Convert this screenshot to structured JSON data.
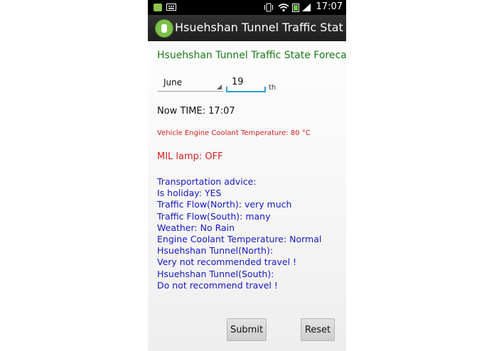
{
  "status_bar": {
    "time": "17:07",
    "icons": [
      "app-notification-icon",
      "keyboard-icon",
      "vibrate-icon",
      "wifi-icon",
      "battery-icon",
      "signal-icon"
    ]
  },
  "action_bar": {
    "title": "Hsuehshan Tunnel Traffic Status For..."
  },
  "form": {
    "heading": "Hsuehshan Tunnel Traffic State Forecast",
    "month": "June",
    "day": "19",
    "day_suffix": "th"
  },
  "info": {
    "now_time": "Now TIME: 17:07",
    "coolant": "Vehicle Engine Coolant Temperature: 80 °C",
    "mil": "MIL lamp: OFF"
  },
  "advice": {
    "title": "Transportation advice:",
    "lines": [
      "Is holiday: YES",
      "Traffic Flow(North): very much",
      "Traffic Flow(South): many",
      "Weather: No Rain",
      "Engine Coolant Temperature: Normal",
      "Hsuehshan Tunnel(North):",
      "Very not recommended travel !",
      "Hsuehshan Tunnel(South):",
      "Do not recommend travel !"
    ]
  },
  "buttons": {
    "submit": "Submit",
    "reset": "Reset"
  },
  "colors": {
    "heading": "#1a7a1a",
    "warning": "#d42020",
    "advice": "#1818c0",
    "accent": "#2aa0d8"
  }
}
